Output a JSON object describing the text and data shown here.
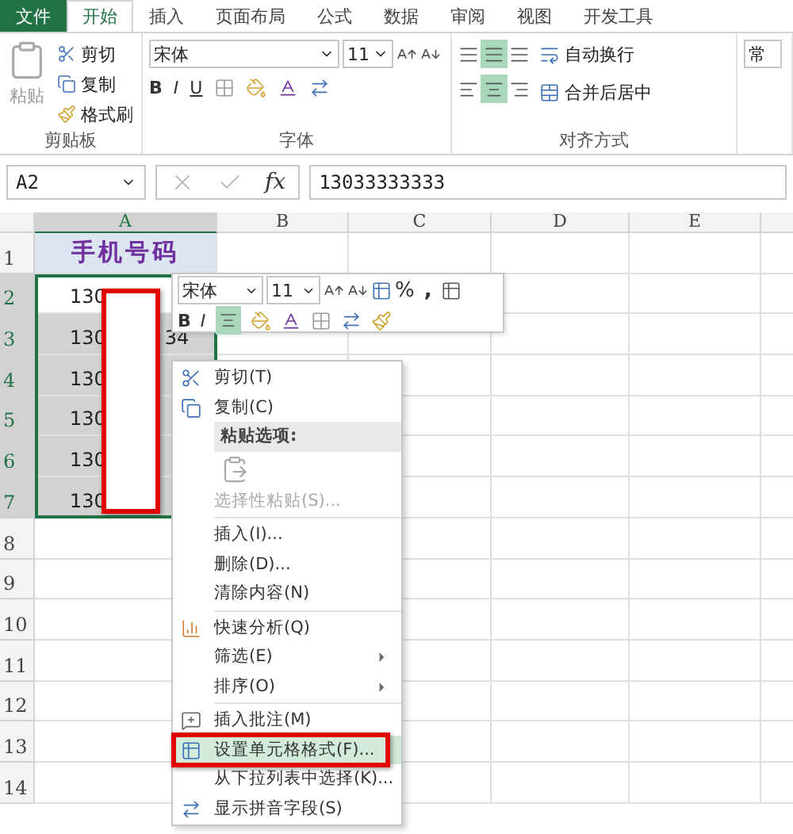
{
  "tabs": [
    {
      "label": "文件",
      "kind": "file",
      "selected": false
    },
    {
      "label": "开始",
      "kind": "tab",
      "selected": true
    },
    {
      "label": "插入",
      "kind": "tab",
      "selected": false
    },
    {
      "label": "页面布局",
      "kind": "tab",
      "selected": false
    },
    {
      "label": "公式",
      "kind": "tab",
      "selected": false
    },
    {
      "label": "数据",
      "kind": "tab",
      "selected": false
    },
    {
      "label": "审阅",
      "kind": "tab",
      "selected": false
    },
    {
      "label": "视图",
      "kind": "tab",
      "selected": false
    },
    {
      "label": "开发工具",
      "kind": "tab",
      "selected": false
    }
  ],
  "ribbon": {
    "clipboard": {
      "title": "剪贴板",
      "paste": "粘贴",
      "cut": "剪切",
      "copy": "复制",
      "format_painter": "格式刷"
    },
    "font": {
      "title": "字体",
      "font_name": "宋体",
      "font_size": "11",
      "bold": "B",
      "italic": "I",
      "underline": "U"
    },
    "alignment": {
      "title": "对齐方式",
      "wrap_text": "自动换行",
      "merge_center": "合并后居中"
    },
    "number": {
      "format": "常"
    }
  },
  "formula_bar": {
    "name_box": "A2",
    "function_label": "fx",
    "value": "13033333333"
  },
  "sheet": {
    "columns": [
      {
        "label": "A",
        "selected": true
      },
      {
        "label": "B",
        "selected": false
      },
      {
        "label": "C",
        "selected": false
      },
      {
        "label": "D",
        "selected": false
      },
      {
        "label": "E",
        "selected": false
      }
    ],
    "header_cell": "手机号码",
    "rows": [
      {
        "number": "1",
        "selected": false
      },
      {
        "number": "2",
        "start": "130",
        "selected": true,
        "active": true
      },
      {
        "number": "3",
        "start": "130",
        "end": "34",
        "selected": true,
        "active": false
      },
      {
        "number": "4",
        "start": "130",
        "selected": true,
        "active": false
      },
      {
        "number": "5",
        "start": "130",
        "selected": true,
        "active": false
      },
      {
        "number": "6",
        "start": "130",
        "selected": true,
        "active": false
      },
      {
        "number": "7",
        "start": "130",
        "selected": true,
        "active": false
      },
      {
        "number": "8",
        "selected": false
      },
      {
        "number": "9",
        "selected": false
      },
      {
        "number": "10",
        "selected": false
      },
      {
        "number": "11",
        "selected": false
      },
      {
        "number": "12",
        "selected": false
      },
      {
        "number": "13",
        "selected": false
      },
      {
        "number": "14",
        "selected": false
      }
    ]
  },
  "mini_toolbar": {
    "font_name": "宋体",
    "font_size": "11",
    "bold": "B",
    "italic": "I",
    "percent": "%",
    "comma": ","
  },
  "context_menu": [
    {
      "kind": "item",
      "label": "剪切(T)",
      "disabled": false,
      "selected": false
    },
    {
      "kind": "item",
      "label": "复制(C)",
      "disabled": false,
      "selected": false
    },
    {
      "kind": "header",
      "label": "粘贴选项:"
    },
    {
      "kind": "paste"
    },
    {
      "kind": "item",
      "label": "选择性粘贴(S)...",
      "disabled": true,
      "selected": false
    },
    {
      "kind": "divider"
    },
    {
      "kind": "item",
      "label": "插入(I)...",
      "disabled": false,
      "selected": false
    },
    {
      "kind": "item",
      "label": "删除(D)...",
      "disabled": false,
      "selected": false
    },
    {
      "kind": "item",
      "label": "清除内容(N)",
      "disabled": false,
      "selected": false
    },
    {
      "kind": "divider"
    },
    {
      "kind": "item",
      "label": "快速分析(Q)",
      "disabled": false,
      "selected": false
    },
    {
      "kind": "item",
      "label": "筛选(E)",
      "submenu": true,
      "disabled": false,
      "selected": false
    },
    {
      "kind": "item",
      "label": "排序(O)",
      "submenu": true,
      "disabled": false,
      "selected": false
    },
    {
      "kind": "divider"
    },
    {
      "kind": "item",
      "label": "插入批注(M)",
      "disabled": false,
      "selected": false
    },
    {
      "kind": "item",
      "label": "设置单元格格式(F)...",
      "disabled": false,
      "selected": true,
      "highlighted": true
    },
    {
      "kind": "item",
      "label": "从下拉列表中选择(K)...",
      "disabled": false,
      "selected": false
    },
    {
      "kind": "item",
      "label": "显示拼音字段(S)",
      "disabled": false,
      "selected": false
    }
  ]
}
